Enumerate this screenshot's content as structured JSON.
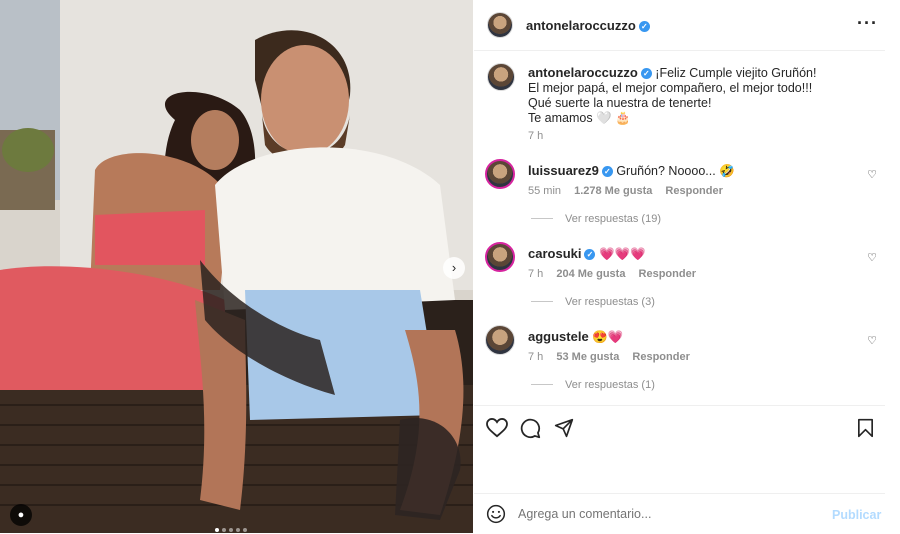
{
  "post": {
    "username": "antonelaroccuzzo",
    "caption_lines": [
      "¡Feliz Cumple viejito Gruñón!",
      "El mejor papá, el mejor compañero, el mejor todo!!!",
      "Qué suerte la nuestra de tenerte!",
      "Te amamos"
    ],
    "caption_emoji": "🤍 🎂",
    "time": "7 h"
  },
  "comments": [
    {
      "username": "luissuarez9",
      "verified": true,
      "text": "Gruñón? Noooo...",
      "emoji": "🤣",
      "time": "55 min",
      "likes": "1.278 Me gusta",
      "reply_label": "Responder",
      "replies": "Ver respuestas (19)"
    },
    {
      "username": "carosuki",
      "verified": true,
      "text": "",
      "emoji": "💗💗💗",
      "time": "7 h",
      "likes": "204 Me gusta",
      "reply_label": "Responder",
      "replies": "Ver respuestas (3)"
    },
    {
      "username": "aggustele",
      "verified": false,
      "text": "",
      "emoji": "😍💗",
      "time": "7 h",
      "likes": "53 Me gusta",
      "reply_label": "Responder",
      "replies": "Ver respuestas (1)"
    }
  ],
  "composer": {
    "placeholder": "Agrega un comentario...",
    "publish": "Publicar"
  },
  "carousel": {
    "dots": 5,
    "active": 1
  },
  "colors": {
    "verified": "#3897f0",
    "publish_disabled": "#b3dbff",
    "muted": "#8e8e8e"
  }
}
